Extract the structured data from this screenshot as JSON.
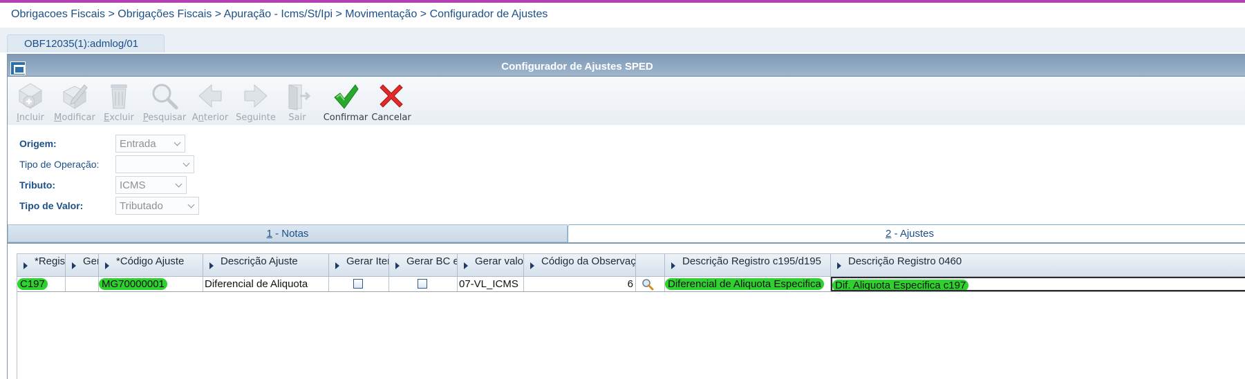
{
  "breadcrumb": "Obrigacoes Fiscais > Obrigações Fiscais > Apuração - Icms/St/Ipi > Movimentação > Configurador de Ajustes",
  "session_tab": "OBF12035(1):admlog/01",
  "window_title": "Configurador de Ajustes SPED",
  "toolbar": {
    "incluir": {
      "pre": "",
      "key": "I",
      "rest": "ncluir"
    },
    "modificar": {
      "pre": "",
      "key": "M",
      "rest": "odificar"
    },
    "excluir": {
      "pre": "",
      "key": "E",
      "rest": "xcluir"
    },
    "pesquisar": {
      "pre": "",
      "key": "P",
      "rest": "esquisar"
    },
    "anterior": {
      "pre": "A",
      "key": "n",
      "rest": "terior"
    },
    "seguinte": {
      "pre": "Se",
      "key": "g",
      "rest": "uinte"
    },
    "sair": "Sair",
    "confirmar": "Confirmar",
    "cancelar": "Cancelar"
  },
  "form": {
    "origem_label": "Origem:",
    "origem_value": "Entrada",
    "tipo_operacao_label": "Tipo de Operação:",
    "tipo_operacao_value": "",
    "tributo_label": "Tributo:",
    "tributo_value": "ICMS",
    "tipo_valor_label": "Tipo de Valor:",
    "tipo_valor_value": "Tributado"
  },
  "tabs": {
    "notas_key": "1",
    "notas_rest": " - Notas",
    "ajustes_key": "2",
    "ajustes_rest": " - Ajustes"
  },
  "grid": {
    "headers": [
      "*Regist",
      "Ger",
      "*Código Ajuste",
      "Descrição Ajuste",
      "Gerar Iten",
      "Gerar BC e",
      "Gerar valor",
      "Código da Observaçã",
      "",
      "Descrição Registro c195/d195",
      "Descrição Registro 0460"
    ],
    "rows": [
      {
        "registro": "C197",
        "ger": "",
        "codigo_ajuste": "MG70000001",
        "descricao_ajuste": "Diferencial de Aliquota",
        "gerar_itens": false,
        "gerar_bc": false,
        "gerar_valor": "07-VL_ICMS",
        "codigo_observacao": "6",
        "descricao_c195": "Diferencial de Aliquota Especifica",
        "descricao_0460": "Dif. Aliquota Especifica c197"
      }
    ]
  },
  "colors": {
    "highlight": "#2fd12f",
    "brand_text": "#1b4f86",
    "titlebar": "#8aa4bf",
    "accent_top": "#b33fb4"
  }
}
